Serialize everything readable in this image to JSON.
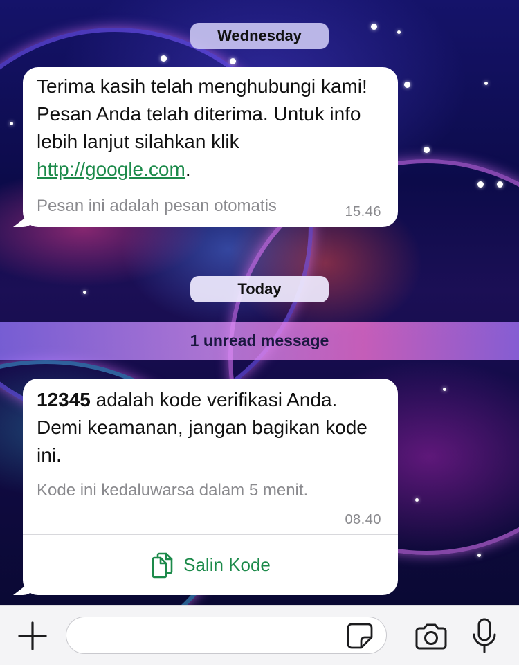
{
  "chat": {
    "date_separators": {
      "first": "Wednesday",
      "second": "Today"
    },
    "unread_banner": "1 unread message",
    "messages": [
      {
        "text_before_link": "Terima kasih telah menghubungi kami! Pesan Anda telah diterima. Untuk info lebih lanjut silahkan klik ",
        "link": "http://google.com",
        "text_after_link": ".",
        "footer": "Pesan ini adalah pesan otomatis",
        "time": "15.46"
      },
      {
        "code": "12345",
        "text_after_code": " adalah kode verifikasi Anda. Demi keamanan, jangan bagikan kode ini.",
        "footer": "Kode ini kedaluwarsa dalam 5 menit.",
        "time": "08.40",
        "copy_button": "Salin Kode"
      }
    ]
  },
  "composer": {
    "input_value": "",
    "icons": {
      "add": "plus-icon",
      "sticker": "sticker-icon",
      "camera": "camera-icon",
      "mic": "microphone-icon"
    }
  },
  "colors": {
    "link_green": "#1c8a4a",
    "bubble_bg": "#ffffff",
    "meta_gray": "#8a8a8e",
    "input_bar_bg": "#f4f4f6"
  }
}
